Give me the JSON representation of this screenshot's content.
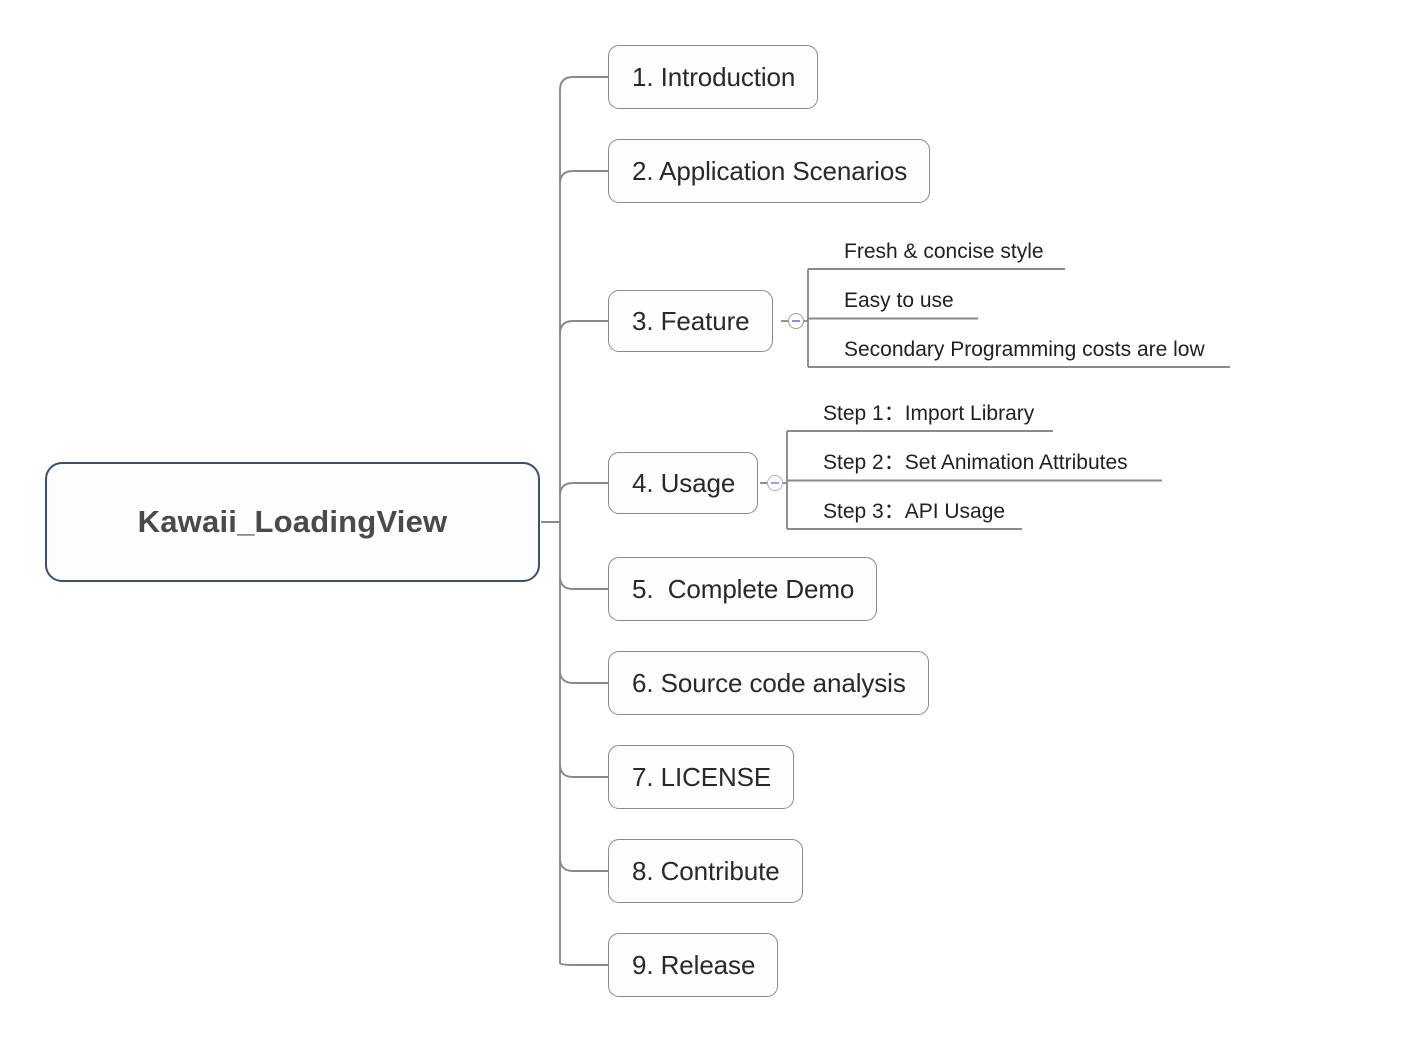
{
  "diagram": {
    "type": "mindmap",
    "title": "Kawaii_LoadingView",
    "background_color": "#ffffff",
    "root": {
      "label": "Kawaii_LoadingView",
      "border_color": "#3c4f6e",
      "fill_color": "#fdfdfd",
      "text_color": "#4a4a4a"
    },
    "branch_color": "#8a8a8a",
    "branches": [
      {
        "label": "1. Introduction",
        "has_children": false
      },
      {
        "label": "2. Application Scenarios",
        "has_children": false
      },
      {
        "label": "3. Feature",
        "has_children": true,
        "toggle": {
          "state": "expanded",
          "icon": "minus-circle-icon"
        },
        "children": [
          {
            "label": "Fresh & concise style"
          },
          {
            "label": "Easy to use"
          },
          {
            "label": "Secondary Programming costs are low"
          }
        ]
      },
      {
        "label": "4. Usage",
        "has_children": true,
        "toggle": {
          "state": "expanded",
          "icon": "minus-circle-icon"
        },
        "children": [
          {
            "label": "Step 1：Import Library"
          },
          {
            "label": "Step 2：Set Animation Attributes"
          },
          {
            "label": "Step 3：API Usage"
          }
        ]
      },
      {
        "label": "5.  Complete Demo",
        "has_children": false
      },
      {
        "label": "6. Source code analysis",
        "has_children": false
      },
      {
        "label": "7. LICENSE",
        "has_children": false
      },
      {
        "label": "8. Contribute",
        "has_children": false
      },
      {
        "label": "9. Release",
        "has_children": false
      }
    ]
  }
}
